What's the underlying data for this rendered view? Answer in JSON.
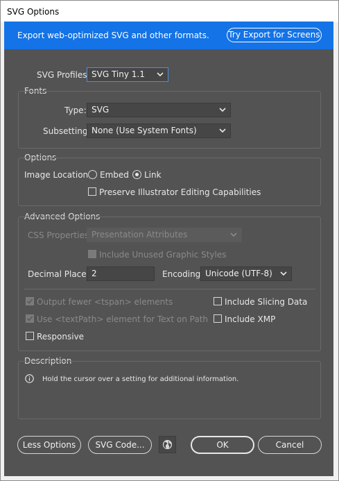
{
  "window": {
    "title": "SVG Options"
  },
  "banner": {
    "message": "Export web-optimized SVG and other formats.",
    "button_label": "Try Export for Screens"
  },
  "svg_profiles": {
    "label": "SVG Profiles:",
    "value": "SVG Tiny 1.1"
  },
  "fonts": {
    "header": "Fonts",
    "type_label": "Type:",
    "type_value": "SVG",
    "subsetting_label": "Subsetting:",
    "subsetting_value": "None (Use System Fonts)"
  },
  "options": {
    "header": "Options",
    "image_location_label": "Image Location:",
    "embed_label": "Embed",
    "link_label": "Link",
    "selected_location": "Link",
    "preserve_label": "Preserve Illustrator Editing Capabilities"
  },
  "advanced": {
    "header": "Advanced Options",
    "css_label": "CSS Properties:",
    "css_value": "Presentation Attributes",
    "unused_styles_label": "Include Unused Graphic Styles",
    "decimal_label": "Decimal Places:",
    "decimal_value": "2",
    "encoding_label": "Encoding:",
    "encoding_value": "Unicode (UTF-8)",
    "tspan_label": "Output fewer <tspan> elements",
    "textpath_label": "Use <textPath> element for Text on Path",
    "responsive_label": "Responsive",
    "slicing_label": "Include Slicing Data",
    "xmp_label": "Include XMP"
  },
  "description": {
    "header": "Description",
    "text": "Hold the cursor over a setting for additional information."
  },
  "footer": {
    "less_options": "Less Options",
    "svg_code": "SVG Code...",
    "ok": "OK",
    "cancel": "Cancel"
  },
  "colors": {
    "accent": "#1473e6",
    "panel": "#535353"
  },
  "icons": {
    "chevron": "chevron-down-icon",
    "info": "info-icon",
    "globe": "globe-icon",
    "check": "check-icon"
  }
}
